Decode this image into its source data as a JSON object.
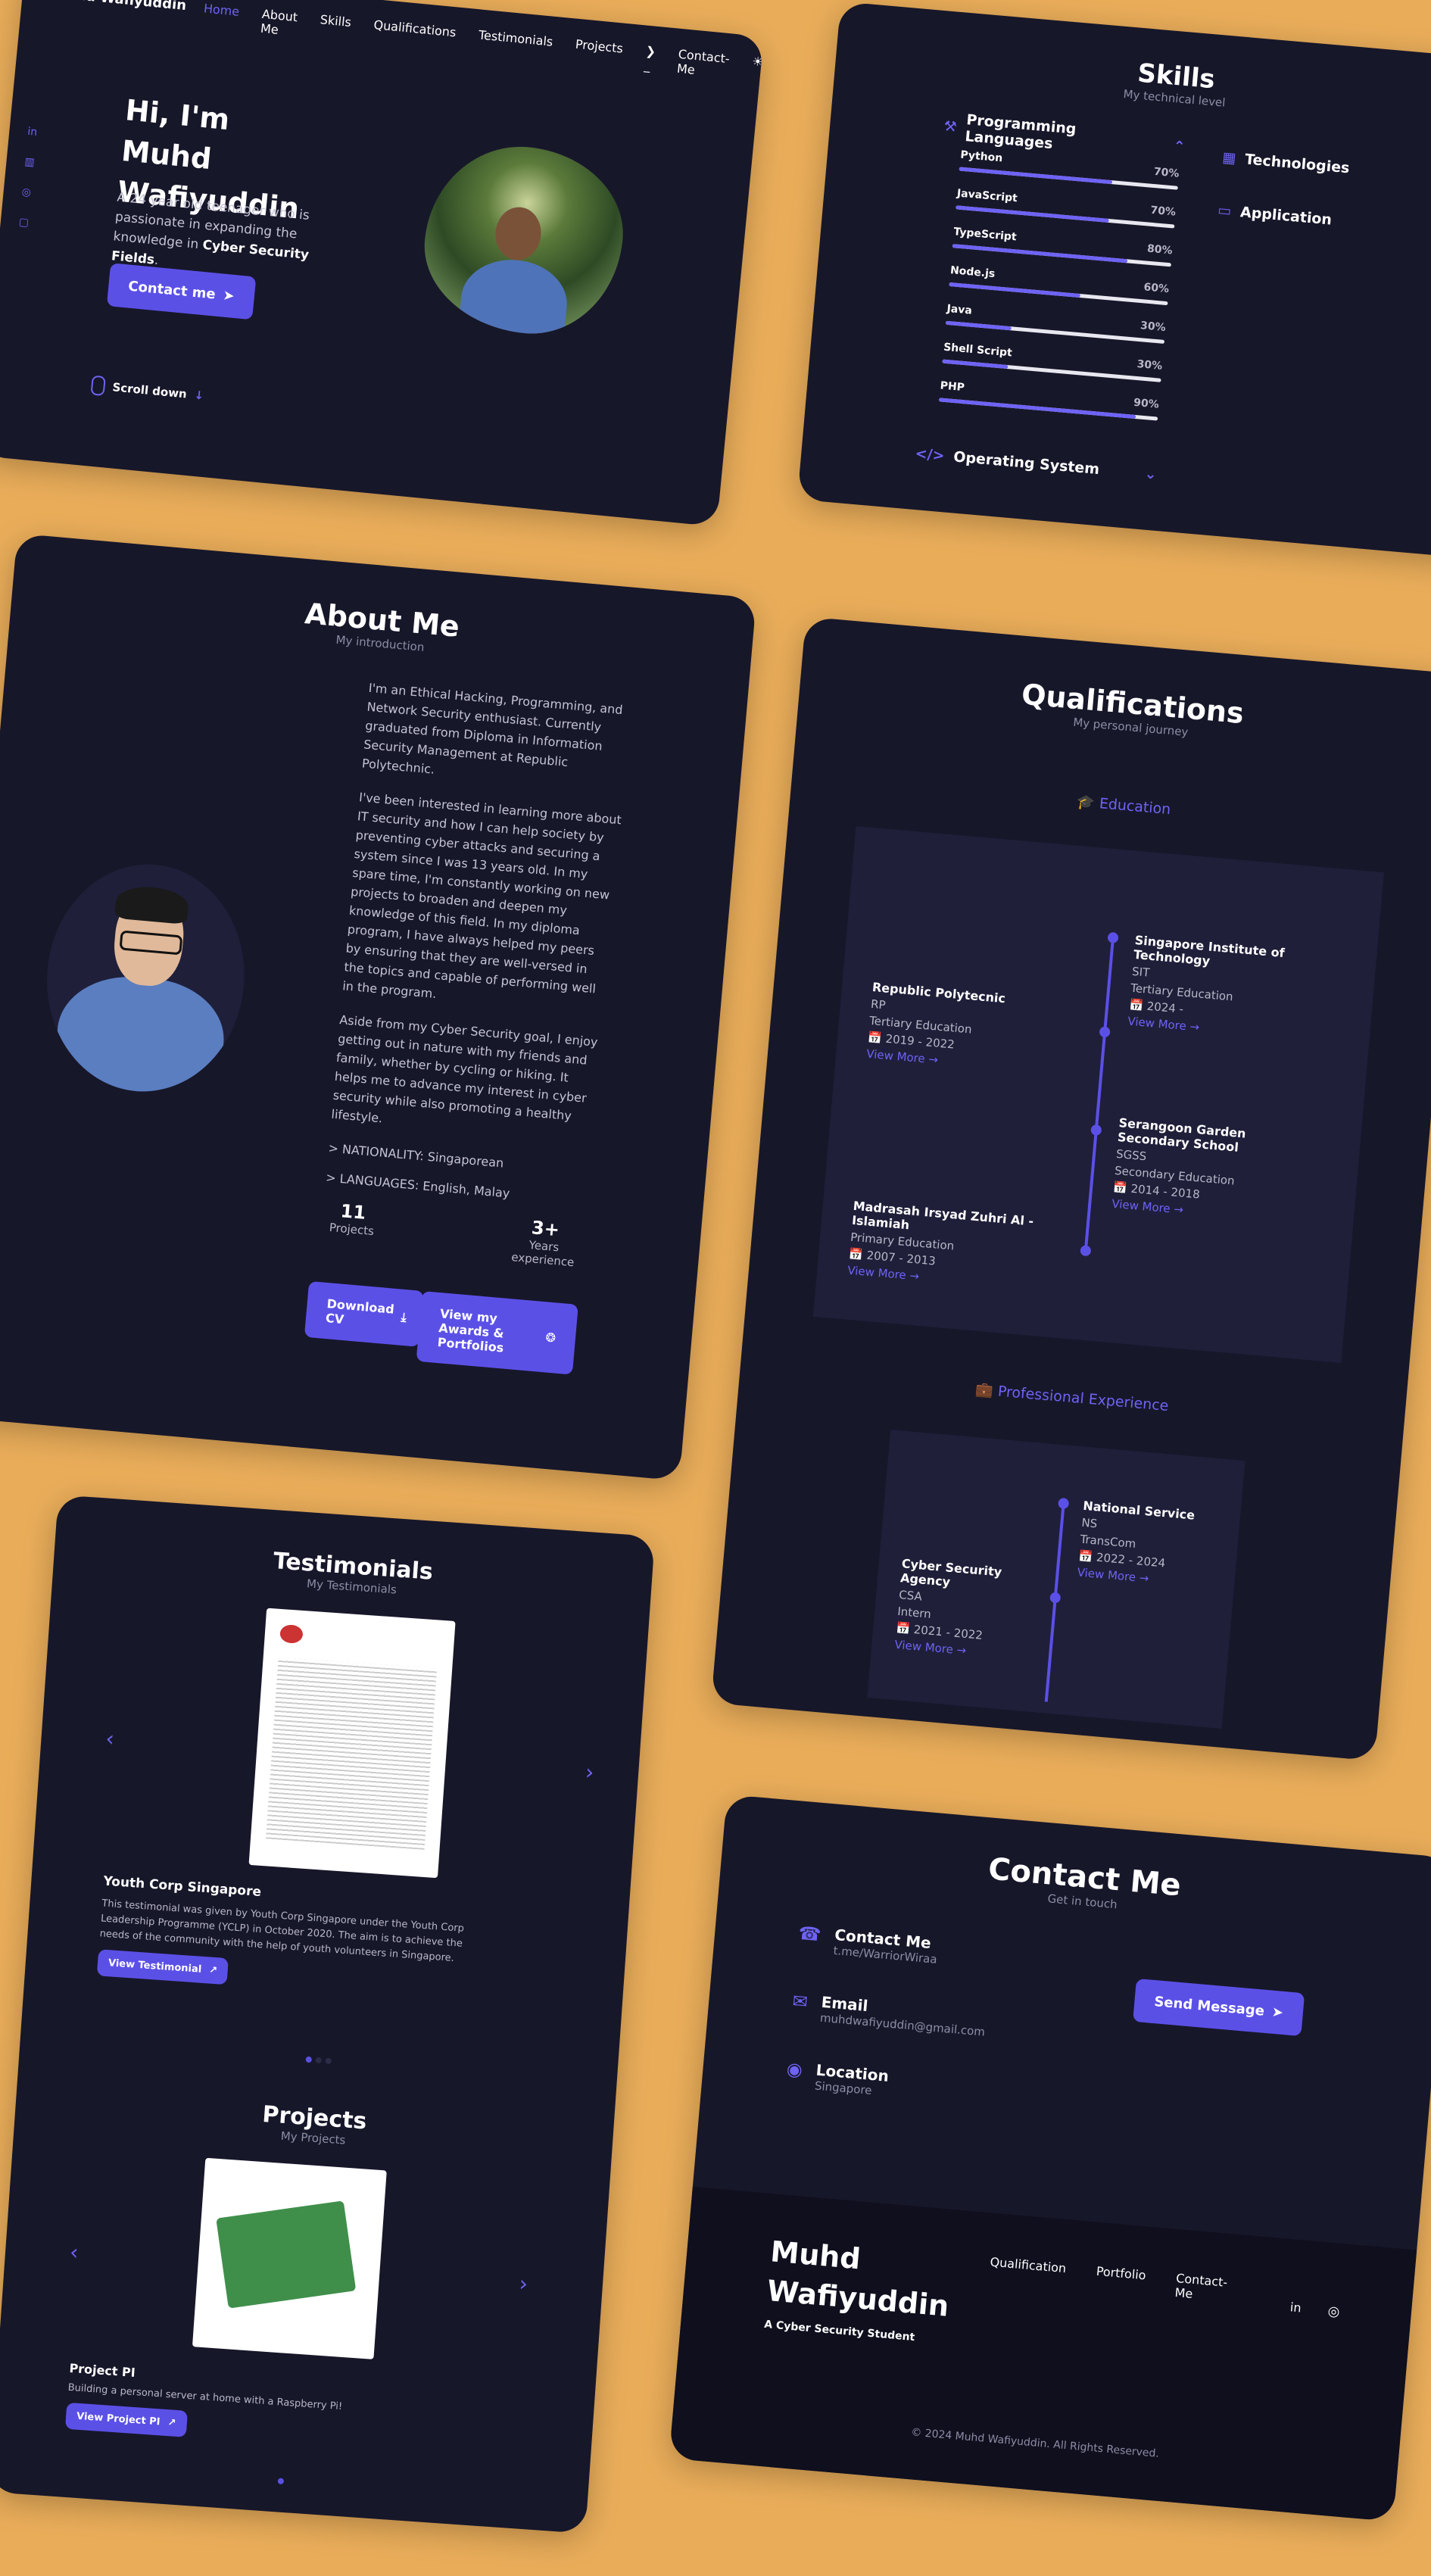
{
  "nav": {
    "brand": "Muhd Wafiyuddin",
    "items": [
      "Home",
      "About Me",
      "Skills",
      "Qualifications",
      "Testimonials",
      "Projects",
      "Contact-Me"
    ]
  },
  "hero": {
    "title": "Hi, I'm Muhd Wafiyuddin",
    "desc_prefix": "A 24 year old teenager who is passionate in expanding the knowledge in ",
    "desc_bold": "Cyber Security Fields",
    "desc_suffix": ".",
    "cta": "Contact me",
    "scroll": "Scroll down"
  },
  "skills": {
    "title": "Skills",
    "subtitle": "My technical level",
    "groups": {
      "programming": "Programming Languages",
      "technologies": "Technologies",
      "application": "Application",
      "os": "Operating System"
    },
    "items": [
      {
        "name": "Python",
        "pct": "70%",
        "level": 0.7
      },
      {
        "name": "JavaScript",
        "pct": "70%",
        "level": 0.7
      },
      {
        "name": "TypeScript",
        "pct": "80%",
        "level": 0.8
      },
      {
        "name": "Node.js",
        "pct": "60%",
        "level": 0.6
      },
      {
        "name": "Java",
        "pct": "30%",
        "level": 0.3
      },
      {
        "name": "Shell Script",
        "pct": "30%",
        "level": 0.3
      },
      {
        "name": "PHP",
        "pct": "90%",
        "level": 0.9
      }
    ]
  },
  "about": {
    "title": "About Me",
    "subtitle": "My introduction",
    "p1": "I'm an Ethical Hacking, Programming, and Network Security enthusiast. Currently graduated from Diploma in Information Security Management at Republic Polytechnic.",
    "p2": "I've been interested in learning more about IT security and how I can help society by preventing cyber attacks and securing a system since I was 13 years old. In my spare time, I'm constantly working on new projects to broaden and deepen my knowledge of this field. In my diploma program, I have always helped my peers by ensuring that they are well-versed in the topics and capable of performing well in the program.",
    "p3": "Aside from my Cyber Security goal, I enjoy getting out in nature with my friends and family, whether by cycling or hiking. It helps me to advance my interest in cyber security while also promoting a healthy lifestyle.",
    "nationality": "> NATIONALITY: Singaporean",
    "languages": "> LANGUAGES: English, Malay",
    "stat1_num": "11",
    "stat1_label": "Projects",
    "stat2_num": "3+",
    "stat2_label": "Years experience",
    "btn_cv": "Download CV",
    "btn_awards": "View my Awards & Portfolios"
  },
  "qualifications": {
    "title": "Qualifications",
    "subtitle": "My personal journey",
    "education_label": "Education",
    "experience_label": "Professional Experience",
    "view_more": "View More",
    "education": [
      {
        "name": "Singapore Institute of Technology",
        "abbr": "SIT",
        "type": "Tertiary Education",
        "date": "2024 -"
      },
      {
        "name": "Republic Polytecnic",
        "abbr": "RP",
        "type": "Tertiary Education",
        "date": "2019 - 2022"
      },
      {
        "name": "Serangoon Garden Secondary School",
        "abbr": "SGSS",
        "type": "Secondary Education",
        "date": "2014 - 2018"
      },
      {
        "name": "Madrasah Irsyad Zuhri Al - Islamiah",
        "abbr": "",
        "type": "Primary Education",
        "date": "2007 - 2013"
      }
    ],
    "experience": [
      {
        "name": "National Service",
        "abbr": "NS",
        "type": "TransCom",
        "date": "2022 - 2024"
      },
      {
        "name": "Cyber Security Agency",
        "abbr": "CSA",
        "type": "Intern",
        "date": "2021 - 2022"
      }
    ]
  },
  "testimonials": {
    "title": "Testimonials",
    "subtitle": "My Testimonials",
    "org": "Youth Corp Singapore",
    "text": "This testimonial was given by Youth Corp Singapore under the Youth Corp Leadership Programme (YCLP) in October 2020. The aim is to achieve the needs of the community with the help of youth volunteers in Singapore.",
    "btn": "View Testimonial"
  },
  "projects": {
    "title": "Projects",
    "subtitle": "My Projects",
    "name": "Project PI",
    "desc": "Building a personal server at home with a Raspberry Pi!",
    "btn": "View Project PI"
  },
  "contact": {
    "title": "Contact Me",
    "subtitle": "Get in touch",
    "items": [
      {
        "label": "Contact Me",
        "value": "t.me/WarriorWiraa"
      },
      {
        "label": "Email",
        "value": "muhdwafiyuddin@gmail.com"
      },
      {
        "label": "Location",
        "value": "Singapore"
      }
    ],
    "send": "Send Message"
  },
  "footer": {
    "name": "Muhd Wafiyuddin",
    "tagline": "A Cyber Security Student",
    "links": [
      "Qualification",
      "Portfolio",
      "Contact-Me"
    ],
    "copyright": "© 2024 Muhd Wafiyuddin. All Rights Reserved."
  },
  "colors": {
    "background": "#e9ad5a",
    "card": "#17172a",
    "accent": "#5b50e6",
    "panel": "#1f1f3a"
  }
}
